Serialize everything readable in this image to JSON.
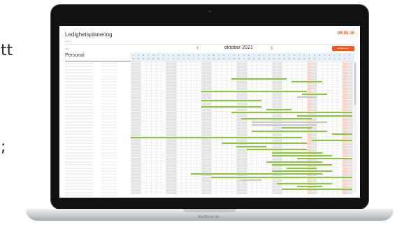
{
  "side_text": {
    "top": "tt",
    "bottom": ";"
  },
  "device": {
    "label": "MacBook Air"
  },
  "app": {
    "title": "Ledighetsplanering",
    "subtitle": "Ad test",
    "clock": "09:55:10"
  },
  "toolbar": {
    "filter_label": "Alla",
    "personal_label": "Personal",
    "month": "oktober 2021",
    "prev": "‹",
    "next": "›",
    "button_label": "Inställningar"
  },
  "calendar": {
    "weekdays": [
      "L",
      "S",
      "M",
      "T",
      "O",
      "T",
      "F",
      "L",
      "S",
      "M",
      "T",
      "O",
      "T",
      "F",
      "L",
      "S",
      "M",
      "T",
      "O",
      "T",
      "F",
      "L",
      "S",
      "M",
      "T",
      "O",
      "T",
      "F",
      "L",
      "S",
      "M",
      "T",
      "O",
      "T",
      "F",
      "L",
      "S",
      "M",
      "T",
      "O",
      "T",
      "F",
      "L",
      "S"
    ],
    "days": [
      "25",
      "26",
      "27",
      "28",
      "29",
      "30",
      "1",
      "2",
      "3",
      "4",
      "5",
      "6",
      "7",
      "8",
      "9",
      "10",
      "11",
      "12",
      "13",
      "14",
      "15",
      "16",
      "17",
      "18",
      "19",
      "20",
      "21",
      "22",
      "23",
      "24",
      "25",
      "26",
      "27",
      "28",
      "29",
      "30",
      "31",
      "1",
      "2",
      "3",
      "4",
      "5",
      "6",
      "7"
    ],
    "weekend_columns": [
      0,
      1,
      7,
      8,
      14,
      15,
      21,
      22,
      28,
      29,
      35,
      36,
      42,
      43
    ],
    "highlight_columns": [
      35,
      42
    ],
    "row_count": 44
  },
  "colors": {
    "accent": "#e85a22",
    "absence_bar": "#8cc63f",
    "pending_bar": "#c8c8c8",
    "header_bg": "#e7f0f7"
  },
  "absences": [
    {
      "row": 5,
      "start": 20,
      "end": 31,
      "kind": "absence"
    },
    {
      "row": 6,
      "start": 32,
      "end": 38,
      "kind": "absence"
    },
    {
      "row": 9,
      "start": 14,
      "end": 35,
      "kind": "absence"
    },
    {
      "row": 10,
      "start": 34,
      "end": 39,
      "kind": "absence"
    },
    {
      "row": 11,
      "start": 33,
      "end": 37,
      "kind": "pending"
    },
    {
      "row": 12,
      "start": 14,
      "end": 26,
      "kind": "absence"
    },
    {
      "row": 14,
      "start": 14,
      "end": 26,
      "kind": "absence"
    },
    {
      "row": 15,
      "start": 27,
      "end": 32,
      "kind": "absence"
    },
    {
      "row": 16,
      "start": 20,
      "end": 44,
      "kind": "absence"
    },
    {
      "row": 17,
      "start": 33,
      "end": 44,
      "kind": "absence"
    },
    {
      "row": 18,
      "start": 22,
      "end": 36,
      "kind": "absence"
    },
    {
      "row": 19,
      "start": 24,
      "end": 39,
      "kind": "pending"
    },
    {
      "row": 20,
      "start": 24,
      "end": 37,
      "kind": "pending"
    },
    {
      "row": 21,
      "start": 30,
      "end": 36,
      "kind": "absence"
    },
    {
      "row": 22,
      "start": 24,
      "end": 39,
      "kind": "absence"
    },
    {
      "row": 23,
      "start": 40,
      "end": 44,
      "kind": "absence"
    },
    {
      "row": 24,
      "start": 0,
      "end": 34,
      "kind": "absence"
    },
    {
      "row": 25,
      "start": 36,
      "end": 44,
      "kind": "absence"
    },
    {
      "row": 26,
      "start": 18,
      "end": 35,
      "kind": "absence"
    },
    {
      "row": 27,
      "start": 21,
      "end": 27,
      "kind": "absence"
    },
    {
      "row": 28,
      "start": 23,
      "end": 35,
      "kind": "absence"
    },
    {
      "row": 29,
      "start": 28,
      "end": 38,
      "kind": "absence"
    },
    {
      "row": 30,
      "start": 28,
      "end": 40,
      "kind": "absence"
    },
    {
      "row": 31,
      "start": 33,
      "end": 44,
      "kind": "absence"
    },
    {
      "row": 32,
      "start": 27,
      "end": 38,
      "kind": "absence"
    },
    {
      "row": 33,
      "start": 28,
      "end": 40,
      "kind": "absence"
    },
    {
      "row": 34,
      "start": 31,
      "end": 37,
      "kind": "absence"
    },
    {
      "row": 35,
      "start": 28,
      "end": 40,
      "kind": "absence"
    },
    {
      "row": 36,
      "start": 12,
      "end": 38,
      "kind": "absence"
    },
    {
      "row": 37,
      "start": 16,
      "end": 44,
      "kind": "absence"
    },
    {
      "row": 38,
      "start": 22,
      "end": 26,
      "kind": "pending"
    },
    {
      "row": 39,
      "start": 29,
      "end": 40,
      "kind": "absence"
    },
    {
      "row": 40,
      "start": 33,
      "end": 38,
      "kind": "absence"
    },
    {
      "row": 41,
      "start": 30,
      "end": 44,
      "kind": "absence"
    },
    {
      "row": 43,
      "start": 22,
      "end": 23,
      "kind": "absence"
    }
  ]
}
